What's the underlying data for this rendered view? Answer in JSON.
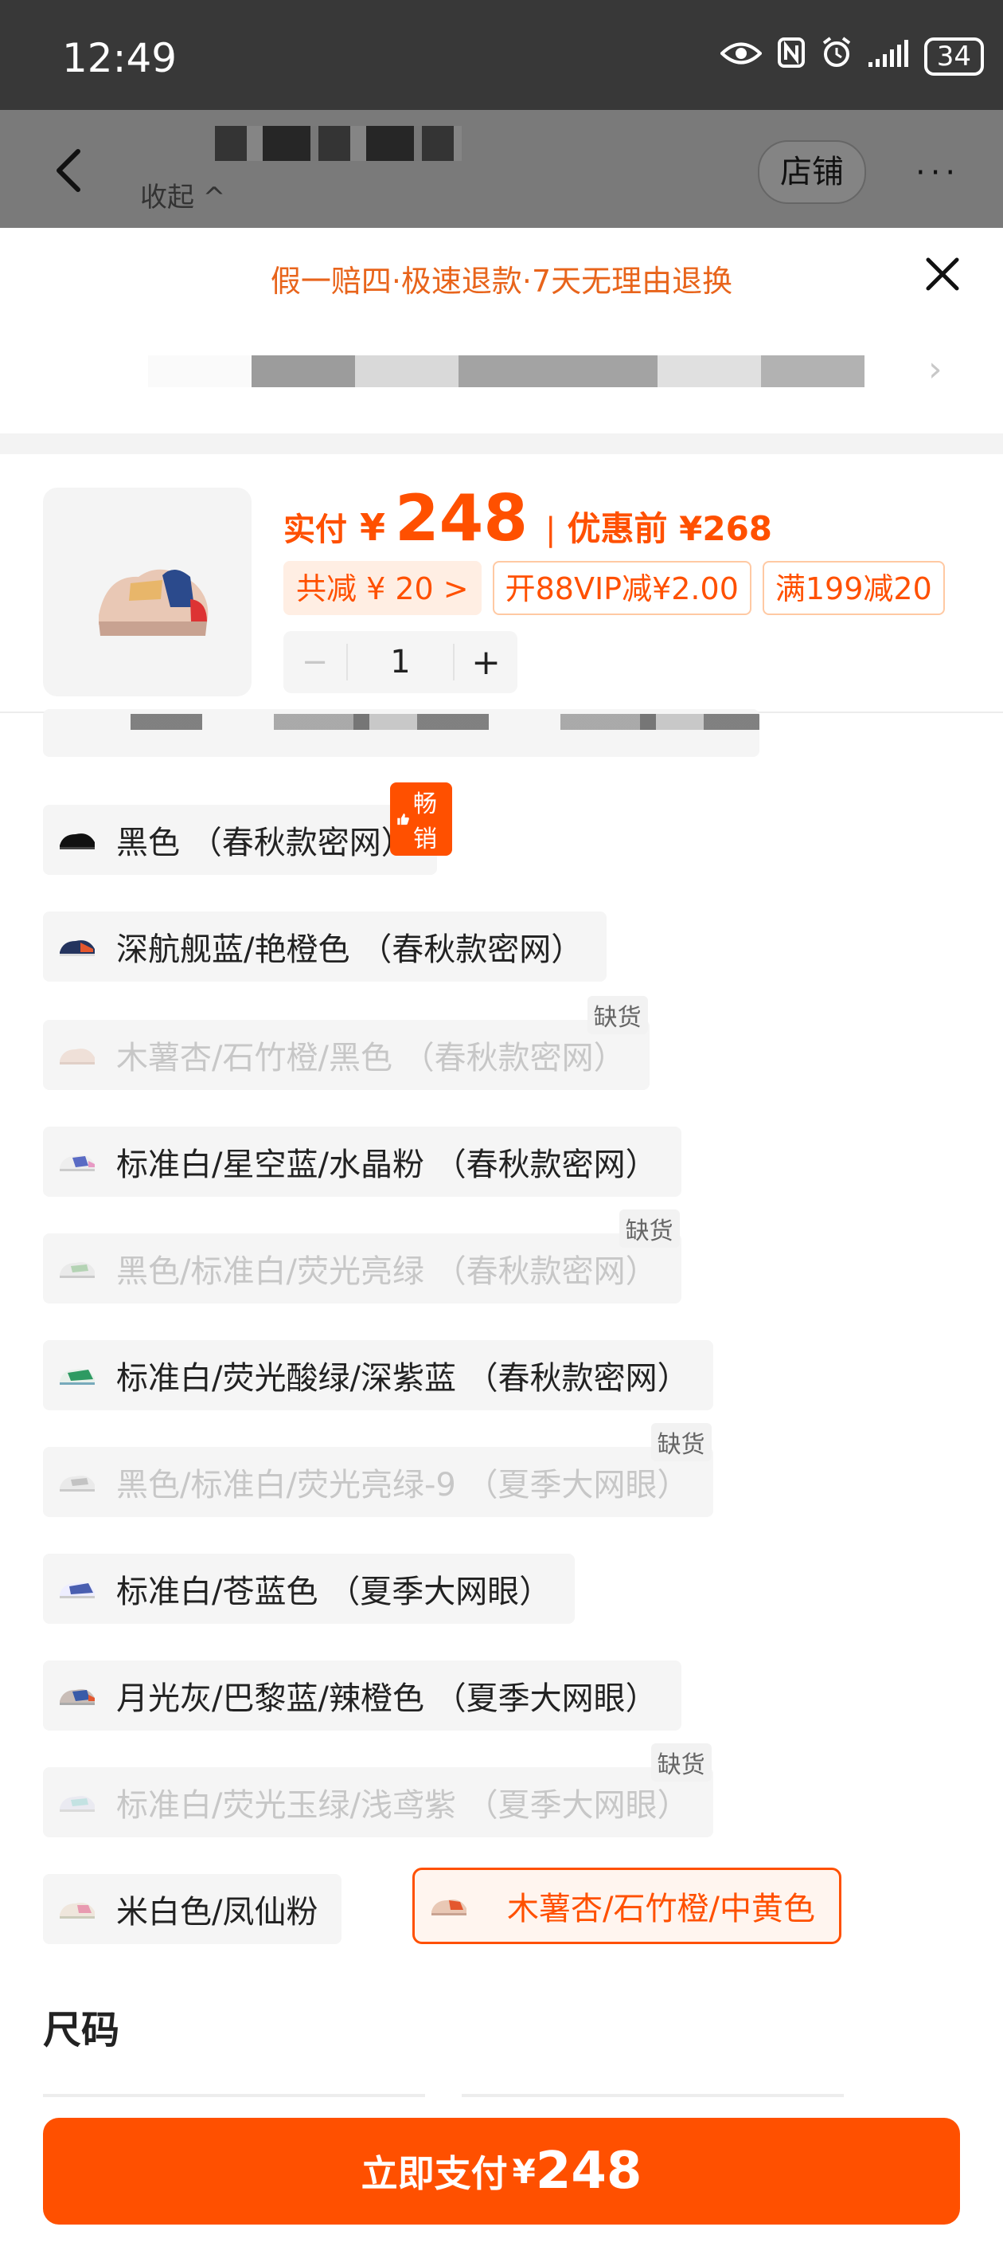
{
  "status_bar": {
    "time": "12:49",
    "battery": "34"
  },
  "header": {
    "collapse_label": "收起 ^",
    "shop_button": "店铺",
    "more": "···"
  },
  "sheet": {
    "guarantee": "假一赔四·极速退款·7天无理由退换",
    "price": {
      "label": "实付",
      "currency": "¥",
      "amount": "248",
      "separator": "|",
      "before_label": "优惠前 ¥268"
    },
    "promos": [
      {
        "text": "共减 ¥ 20 >"
      },
      {
        "text": "开88VIP减¥2.00"
      },
      {
        "text": "满199减20"
      }
    ],
    "stepper": {
      "minus": "−",
      "quantity": "1",
      "plus": "+"
    },
    "hot_badge": "畅销",
    "out_of_stock_badge": "缺货",
    "options": [
      {
        "label": "黑色 （春秋款密网）",
        "state": "hot"
      },
      {
        "label": "深航舰蓝/艳橙色 （春秋款密网）",
        "state": "normal"
      },
      {
        "label": "木薯杏/石竹橙/黑色 （春秋款密网）",
        "state": "out_of_stock"
      },
      {
        "label": "标准白/星空蓝/水晶粉 （春秋款密网）",
        "state": "normal"
      },
      {
        "label": "黑色/标准白/荧光亮绿 （春秋款密网）",
        "state": "out_of_stock"
      },
      {
        "label": "标准白/荧光酸绿/深紫蓝 （春秋款密网）",
        "state": "normal"
      },
      {
        "label": "黑色/标准白/荧光亮绿-9 （夏季大网眼）",
        "state": "out_of_stock"
      },
      {
        "label": "标准白/苍蓝色 （夏季大网眼）",
        "state": "normal"
      },
      {
        "label": "月光灰/巴黎蓝/辣橙色 （夏季大网眼）",
        "state": "normal"
      },
      {
        "label": "标准白/荧光玉绿/浅鸢紫 （夏季大网眼）",
        "state": "out_of_stock"
      },
      {
        "label": "米白色/凤仙粉",
        "state": "normal"
      },
      {
        "label": "木薯杏/石竹橙/中黄色",
        "state": "selected"
      }
    ],
    "size_title": "尺码",
    "pay_button": {
      "label": "立即支付",
      "currency": "¥",
      "amount": "248"
    }
  },
  "colors": {
    "accent": "#ff5000",
    "guarantee": "#e8641b",
    "chip_bg": "#f5f5f5"
  }
}
